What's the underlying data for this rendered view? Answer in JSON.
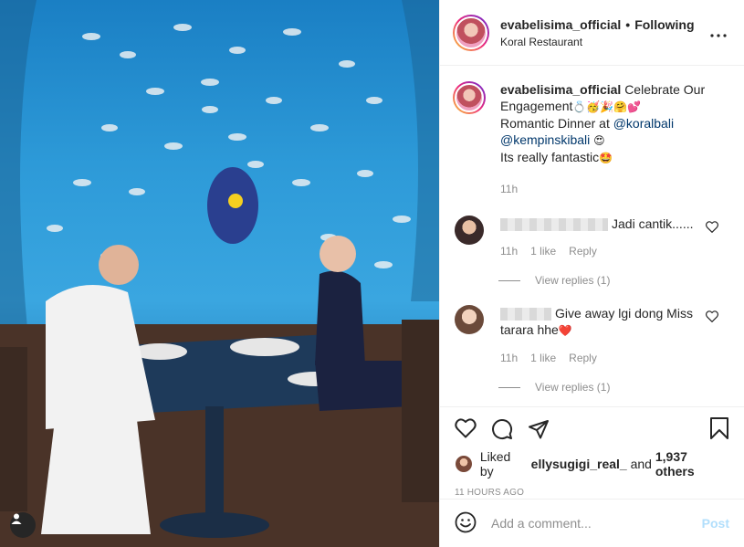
{
  "post": {
    "username": "evabelisima_official",
    "follow_label": "Following",
    "separator": "•",
    "location": "Koral Restaurant",
    "more_icon": "more-dots-icon"
  },
  "caption": {
    "username": "evabelisima_official",
    "line1": "Celebrate Our Engagement",
    "emojis1": "💍🥳🎉🤗💕",
    "line2_prefix": "Romantic Dinner at ",
    "mention1": "@koralbali",
    "mention2": "@kempinskibali",
    "emoji2": "😍",
    "line3": "Its really fantastic",
    "emoji3": "🤩",
    "time": "11h"
  },
  "comments": [
    {
      "text": "Jadi cantik......",
      "time": "11h",
      "likes": "1 like",
      "reply": "Reply",
      "view_replies": "View replies (1)"
    },
    {
      "text": "Give away lgi dong Miss tarara hhe",
      "emoji": "❤️",
      "time": "11h",
      "likes": "1 like",
      "reply": "Reply",
      "view_replies": "View replies (1)"
    }
  ],
  "actions": {
    "like_icon": "heart-icon",
    "comment_icon": "comment-icon",
    "share_icon": "share-icon",
    "save_icon": "bookmark-icon"
  },
  "likes": {
    "prefix": "Liked by ",
    "user": "ellysugigi_real_",
    "mid": " and ",
    "count": "1,937 others"
  },
  "timestamp": "11 HOURS AGO",
  "add_comment": {
    "placeholder": "Add a comment...",
    "post_label": "Post"
  },
  "colors": {
    "link": "#00376b",
    "muted": "#8e8e8e",
    "post_disabled": "#b2dffc"
  }
}
